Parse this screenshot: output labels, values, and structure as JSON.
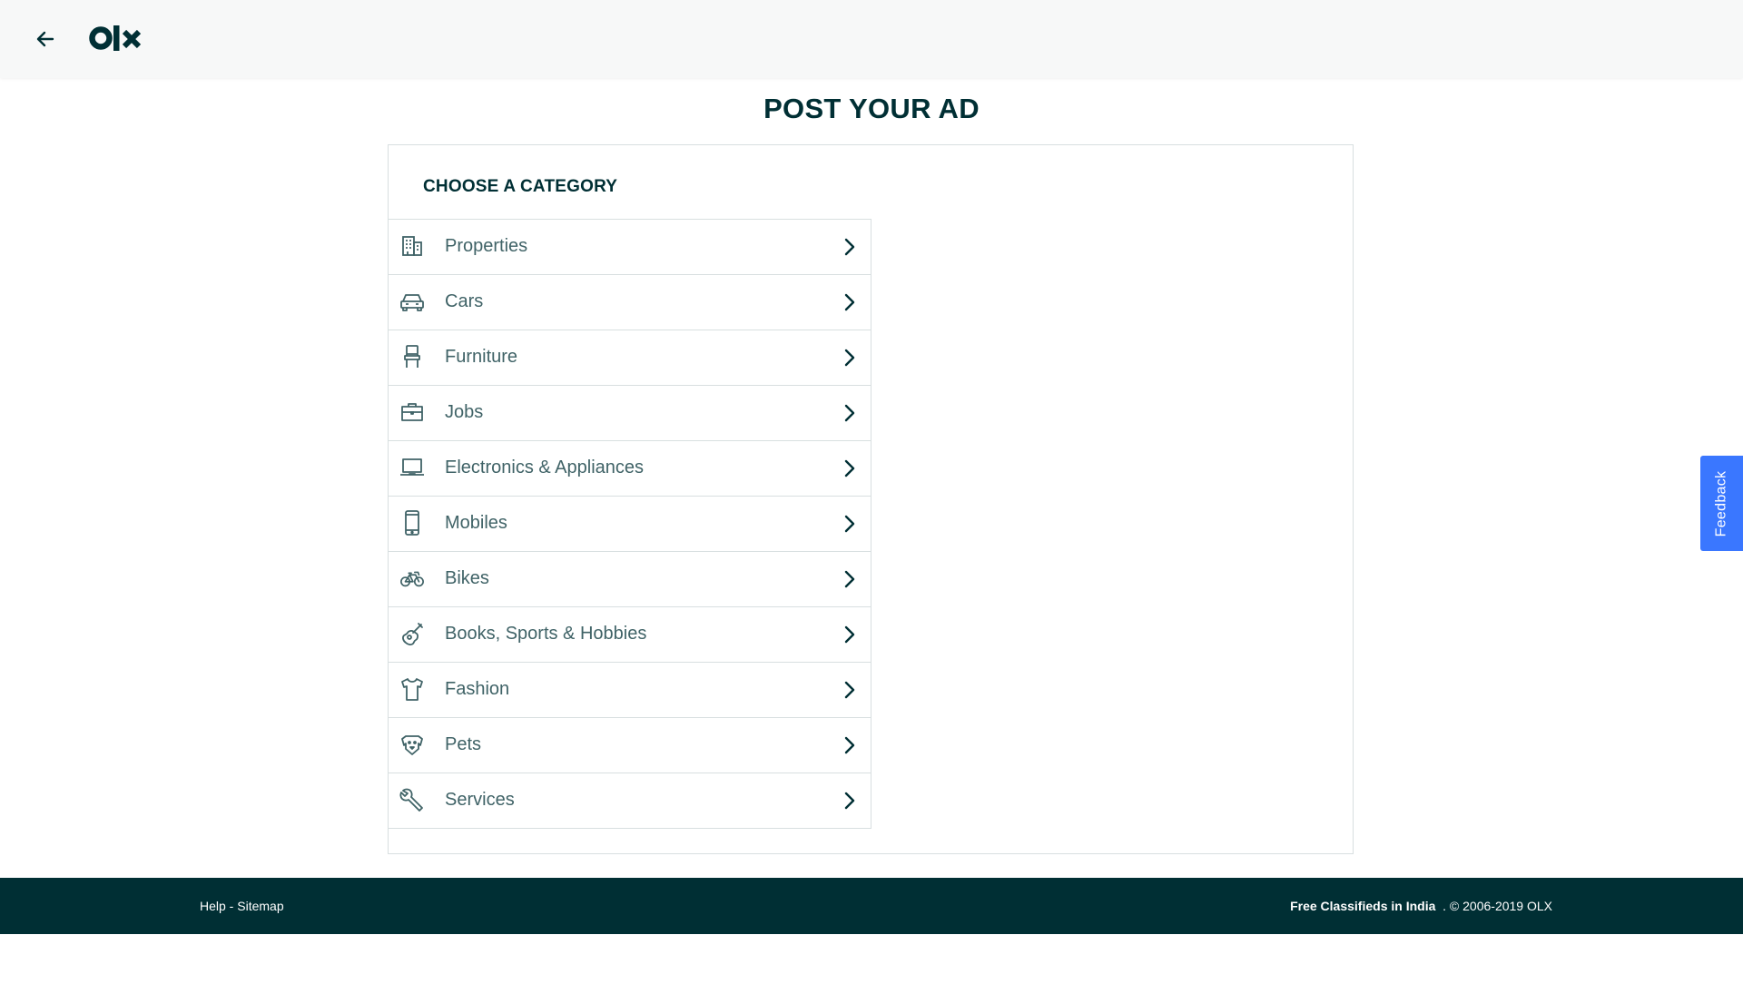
{
  "header": {
    "back_icon": "arrow-left-icon",
    "logo_text": "olx"
  },
  "page": {
    "title": "POST YOUR AD"
  },
  "card": {
    "header": "CHOOSE A CATEGORY",
    "categories": [
      {
        "label": "Properties",
        "icon": "building-icon"
      },
      {
        "label": "Cars",
        "icon": "car-icon"
      },
      {
        "label": "Furniture",
        "icon": "chair-icon"
      },
      {
        "label": "Jobs",
        "icon": "briefcase-icon"
      },
      {
        "label": "Electronics & Appliances",
        "icon": "laptop-icon"
      },
      {
        "label": "Mobiles",
        "icon": "mobile-icon"
      },
      {
        "label": "Bikes",
        "icon": "bike-icon"
      },
      {
        "label": "Books, Sports & Hobbies",
        "icon": "guitar-icon"
      },
      {
        "label": "Fashion",
        "icon": "shirt-icon"
      },
      {
        "label": "Pets",
        "icon": "dog-icon"
      },
      {
        "label": "Services",
        "icon": "wrench-icon"
      }
    ]
  },
  "feedback": {
    "label": "Feedback",
    "color": "#3a77ff"
  },
  "footer": {
    "help": "Help",
    "separator": " - ",
    "sitemap": "Sitemap",
    "tagline": "Free Classifieds in India",
    "copyright": ". © 2006-2019 OLX"
  },
  "colors": {
    "brand_dark": "#002f34",
    "label": "#406367",
    "border": "#d8dfe0",
    "topbar_bg": "#f7f8f8"
  }
}
